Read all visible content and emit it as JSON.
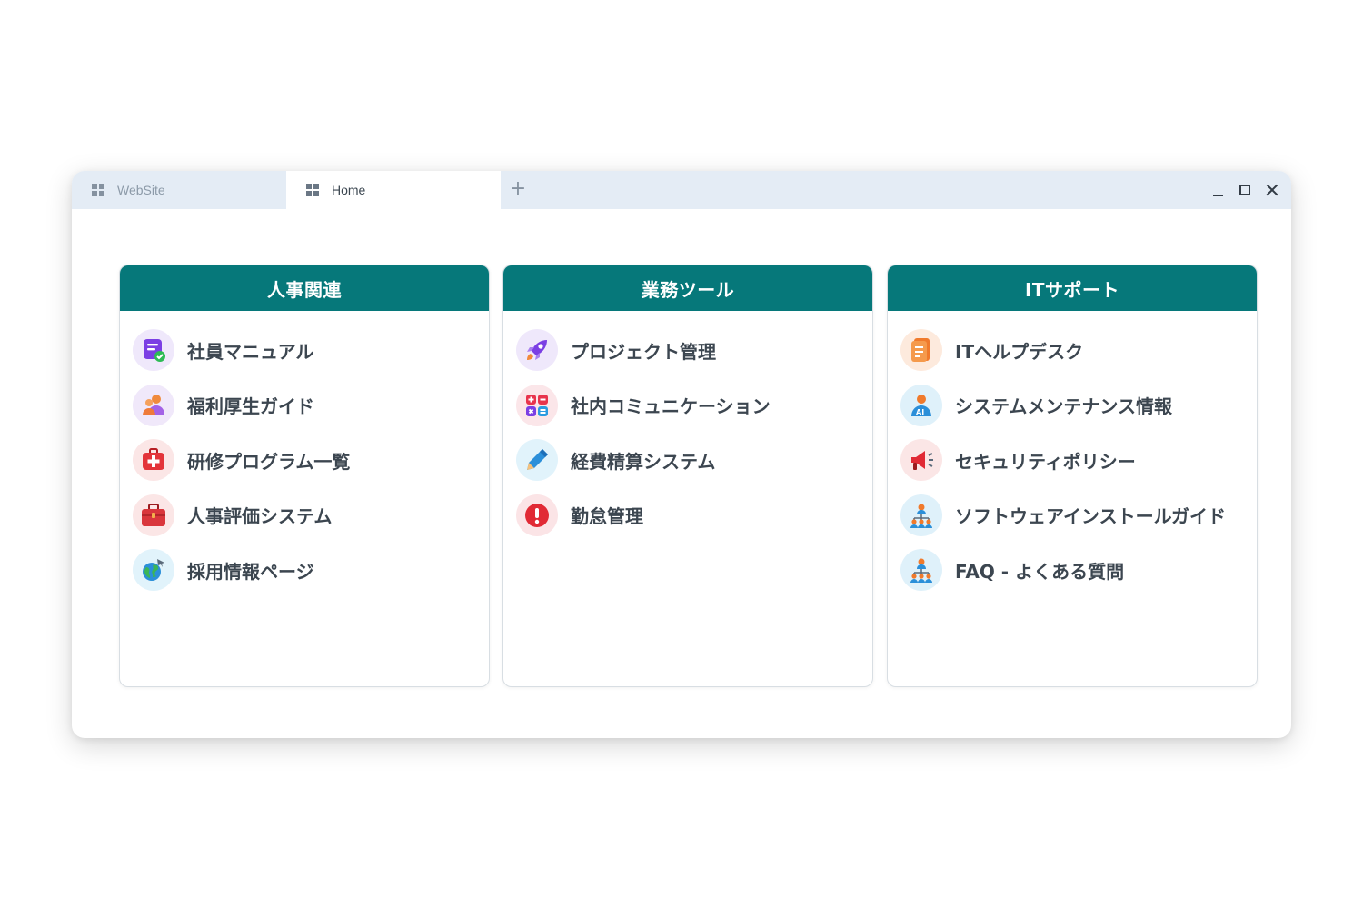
{
  "tabs": [
    {
      "label": "WebSite",
      "active": false
    },
    {
      "label": "Home",
      "active": true
    }
  ],
  "new_tab_label": "+",
  "columns": [
    {
      "title": "人事関連",
      "items": [
        {
          "label": "社員マニュアル",
          "icon": "purple-list-check-icon"
        },
        {
          "label": "福利厚生ガイド",
          "icon": "people-icon"
        },
        {
          "label": "研修プログラム一覧",
          "icon": "first-aid-kit-icon"
        },
        {
          "label": "人事評価システム",
          "icon": "briefcase-icon"
        },
        {
          "label": "採用情報ページ",
          "icon": "globe-plane-icon"
        }
      ]
    },
    {
      "title": "業務ツール",
      "items": [
        {
          "label": "プロジェクト管理",
          "icon": "rocket-icon"
        },
        {
          "label": "社内コミュニケーション",
          "icon": "calculator-icon"
        },
        {
          "label": "経費精算システム",
          "icon": "pencil-icon"
        },
        {
          "label": "勤怠管理",
          "icon": "alert-icon"
        }
      ]
    },
    {
      "title": "ITサポート",
      "items": [
        {
          "label": "ITヘルプデスク",
          "icon": "document-icon"
        },
        {
          "label": "システムメンテナンス情報",
          "icon": "ai-person-icon"
        },
        {
          "label": "セキュリティポリシー",
          "icon": "megaphone-icon"
        },
        {
          "label": "ソフトウェアインストールガイド",
          "icon": "team-network-icon"
        },
        {
          "label": "FAQ - よくある質問",
          "icon": "team-network-icon"
        }
      ]
    }
  ],
  "colors": {
    "header_teal": "#06787a",
    "tabbar": "#e4ecf5",
    "text": "#3c4650"
  }
}
